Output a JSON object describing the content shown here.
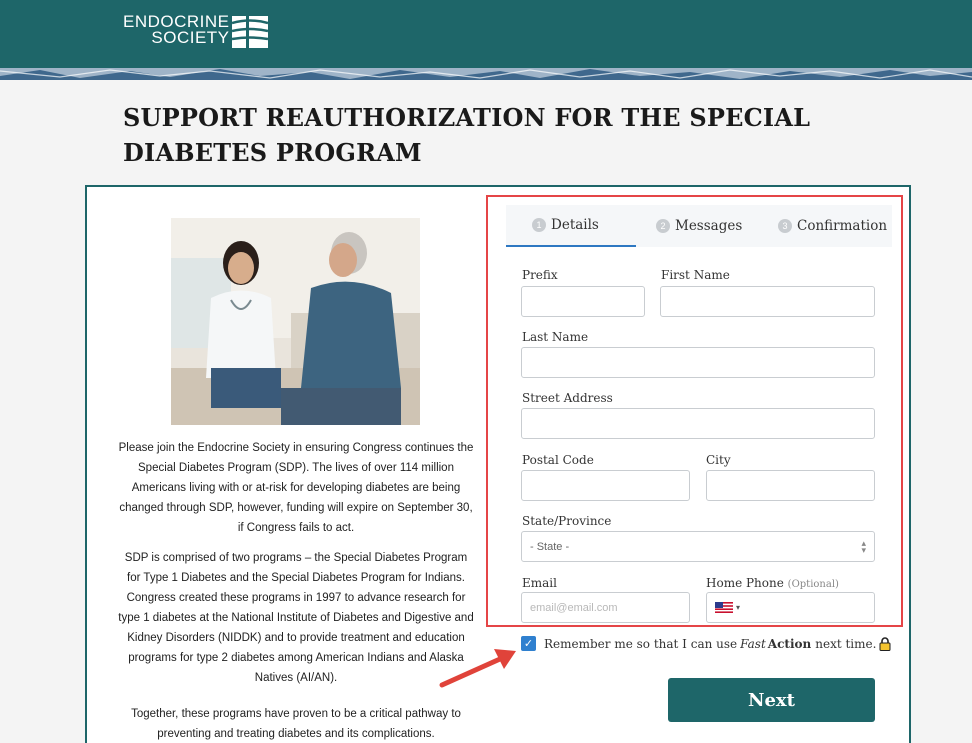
{
  "brand": {
    "line1": "ENDOCRINE",
    "line2": "SOCIETY"
  },
  "page": {
    "title": "SUPPORT REAUTHORIZATION FOR THE SPECIAL DIABETES PROGRAM"
  },
  "intro": {
    "paragraph1": "Please join the Endocrine Society in ensuring Congress continues the Special Diabetes Program (SDP). The lives of over 114 million Americans living with or at-risk for developing diabetes are being changed through SDP, however, funding will expire on September 30, if Congress fails to act.",
    "paragraph2": "SDP is comprised of two programs – the Special Diabetes Program for Type 1 Diabetes and the Special Diabetes Program for Indians. Congress created these programs in 1997 to advance research for type 1 diabetes at the National Institute of Diabetes and Digestive and Kidney Disorders (NIDDK) and to provide treatment and education programs for type 2 diabetes among American Indians and Alaska Natives (AI/AN).",
    "paragraph3": "Together, these programs have proven to be a critical pathway to preventing and treating diabetes and its complications."
  },
  "tabs": [
    {
      "num": "1",
      "label": "Details",
      "active": true
    },
    {
      "num": "2",
      "label": "Messages",
      "active": false
    },
    {
      "num": "3",
      "label": "Confirmation",
      "active": false
    }
  ],
  "form": {
    "prefix": {
      "label": "Prefix",
      "value": ""
    },
    "first_name": {
      "label": "First Name",
      "value": ""
    },
    "last_name": {
      "label": "Last Name",
      "value": ""
    },
    "street": {
      "label": "Street Address",
      "value": ""
    },
    "postal": {
      "label": "Postal Code",
      "value": ""
    },
    "city": {
      "label": "City",
      "value": ""
    },
    "state": {
      "label": "State/Province",
      "selected": "- State -"
    },
    "email": {
      "label": "Email",
      "placeholder": "email@email.com"
    },
    "phone": {
      "label": "Home Phone",
      "optional": "(Optional)"
    }
  },
  "remember": {
    "checked": true,
    "text_before": "Remember me so that I can use",
    "fast": "Fast",
    "action": "Action",
    "text_after": "next time."
  },
  "next_button": "Next",
  "colors": {
    "brand": "#1e6669",
    "highlight_border": "#e54547",
    "accent": "#2f80cf"
  }
}
